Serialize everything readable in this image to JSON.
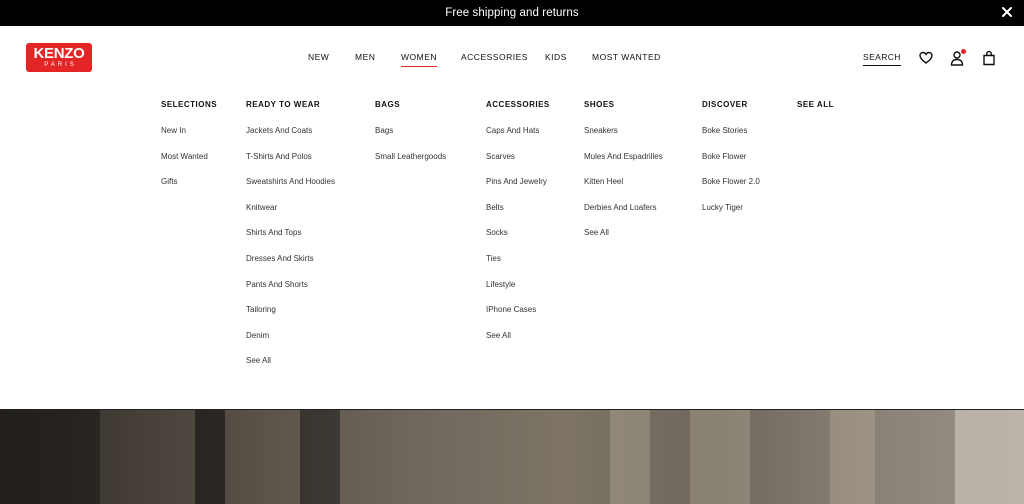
{
  "promo": {
    "text": "Free shipping and returns"
  },
  "brand": {
    "logo_main": "KENZO",
    "logo_sub": "PARIS"
  },
  "main_nav": [
    {
      "label": "NEW",
      "active": false
    },
    {
      "label": "MEN",
      "active": false
    },
    {
      "label": "WOMEN",
      "active": true
    },
    {
      "label": "ACCESSORIES",
      "active": false
    },
    {
      "label": "KIDS",
      "active": false
    },
    {
      "label": "MOST WANTED",
      "active": false
    }
  ],
  "header_actions": {
    "search_label": "SEARCH"
  },
  "icons": {
    "close": "close-icon",
    "wishlist": "heart-icon",
    "account": "user-icon",
    "cart": "bag-icon"
  },
  "colors": {
    "accent": "#e32526",
    "promo_bg": "#000000"
  },
  "mega_menu": {
    "columns": [
      {
        "title": "SELECTIONS",
        "items": [
          "New In",
          "Most Wanted",
          "Gifts"
        ]
      },
      {
        "title": "READY TO WEAR",
        "items": [
          "Jackets And Coats",
          "T-Shirts And Polos",
          "Sweatshirts And Hoodies",
          "Knitwear",
          "Shirts And Tops",
          "Dresses And Skirts",
          "Pants And Shorts",
          "Tailoring",
          "Denim",
          "See All"
        ]
      },
      {
        "title": "BAGS",
        "items": [
          "Bags",
          "Small Leathergoods"
        ]
      },
      {
        "title": "ACCESSORIES",
        "items": [
          "Caps And Hats",
          "Scarves",
          "Pins And Jewelry",
          "Belts",
          "Socks",
          "Ties",
          "Lifestyle",
          "IPhone Cases",
          "See All"
        ]
      },
      {
        "title": "SHOES",
        "items": [
          "Sneakers",
          "Mules And Espadrilles",
          "Kitten Heel",
          "Derbies And Loafers",
          "See All"
        ]
      },
      {
        "title": "DISCOVER",
        "items": [
          "Boke Stories",
          "Boke Flower",
          "Boke Flower 2.0",
          "Lucky Tiger"
        ]
      },
      {
        "title": "SEE ALL",
        "items": []
      }
    ]
  }
}
